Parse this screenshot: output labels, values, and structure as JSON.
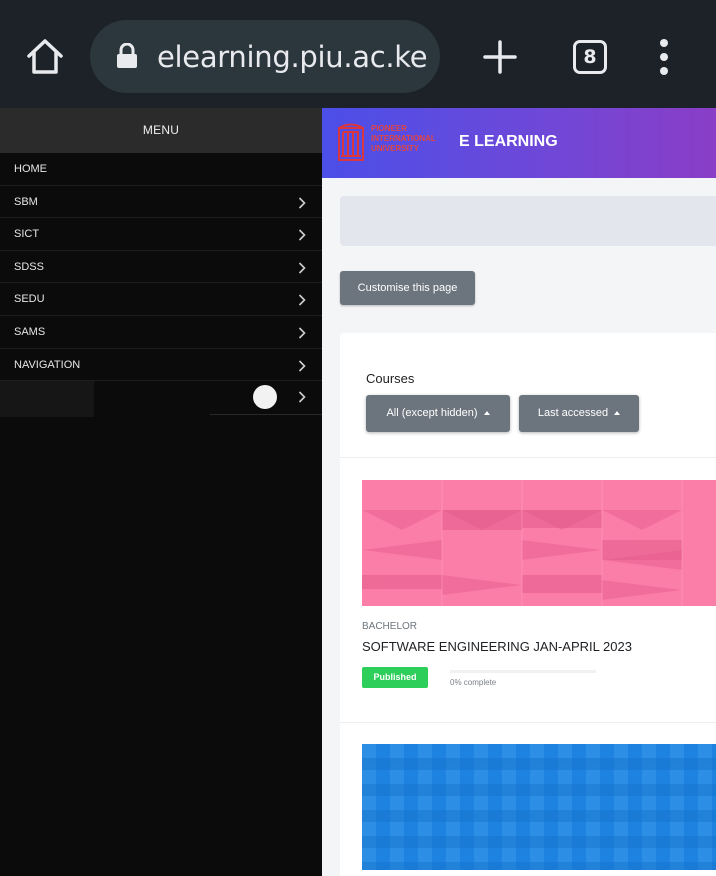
{
  "browser": {
    "url": "elearning.piu.ac.ke/r",
    "tab_count": "8"
  },
  "menu": {
    "header": "MENU",
    "items": [
      {
        "label": "HOME",
        "has_chevron": false
      },
      {
        "label": "SBM",
        "has_chevron": true
      },
      {
        "label": "SICT",
        "has_chevron": true
      },
      {
        "label": "SDSS",
        "has_chevron": true
      },
      {
        "label": "SEDU",
        "has_chevron": true
      },
      {
        "label": "SAMS",
        "has_chevron": true
      },
      {
        "label": "NAVIGATION",
        "has_chevron": true
      }
    ]
  },
  "site": {
    "logo_text_line1": "PIONEER",
    "logo_text_line2": "INTERNATIONAL",
    "logo_text_line3": "UNIVERSITY",
    "name": "E LEARNING",
    "brand_gradient": [
      "#4b4fe8",
      "#8a3dc6"
    ]
  },
  "page": {
    "customise_label": "Customise this page"
  },
  "courses": {
    "title": "Courses",
    "filter_label": "All (except hidden)",
    "sort_label": "Last accessed",
    "items": [
      {
        "category": "BACHELOR",
        "name": "SOFTWARE ENGINEERING JAN-APRIL 2023",
        "status": "Published",
        "progress_text": "0% complete",
        "progress": 0,
        "image_color": "#fb7ea9"
      },
      {
        "image_color": "#1e83e0"
      }
    ]
  }
}
